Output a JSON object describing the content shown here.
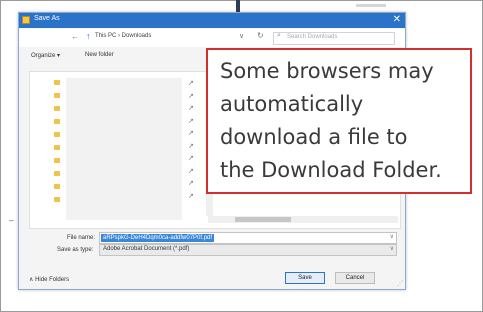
{
  "dialog": {
    "title": "Save As",
    "close_glyph": "✕",
    "breadcrumb": "This PC  ›  Downloads",
    "search_placeholder": "Search Downloads",
    "toolbar": {
      "organize": "Organize ▾",
      "new_folder": "New folder"
    },
    "file_name_label": "File name:",
    "file_name_value": "aRPspkG-DeH4Dqm0ca-addfw07P0f.pdf",
    "save_as_type_label": "Save as type:",
    "save_as_type_value": "Adobe Acrobat Document (*.pdf)",
    "hide_folders": "Hide Folders",
    "save_button": "Save",
    "cancel_button": "Cancel"
  },
  "callout": {
    "lines": [
      "Some browsers may",
      "automatically",
      "download a file to",
      "the Download Folder."
    ],
    "border_color": "#d32f2f"
  },
  "colors": {
    "titlebar": "#2b73c9",
    "selection": "#3a86d8"
  },
  "icons": [
    "folder-icon",
    "pin-icon",
    "search-icon",
    "refresh-icon",
    "close-icon",
    "chevron-down-icon"
  ]
}
